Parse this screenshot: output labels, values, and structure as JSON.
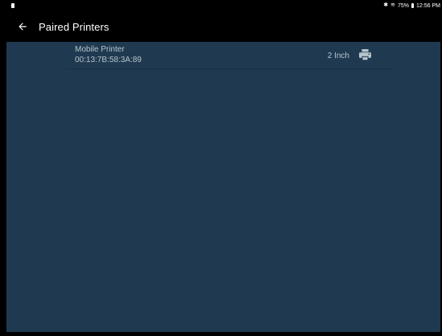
{
  "toolbar": {
    "title": "Paired Printers",
    "back_icon": "arrow-left-icon"
  },
  "status_bar": {
    "time": "12:56 PM",
    "battery": "75%",
    "icons": [
      "bluetooth-icon",
      "wifi-icon",
      "battery-icon"
    ]
  },
  "printers": [
    {
      "name": "Mobile Printer",
      "address": "00:13:7B:58:3A:89",
      "size": "2 Inch",
      "icon": "printer-icon"
    }
  ],
  "colors": {
    "background": "#1f3a50",
    "toolbar": "#000000",
    "text": "#b7c3cc"
  }
}
